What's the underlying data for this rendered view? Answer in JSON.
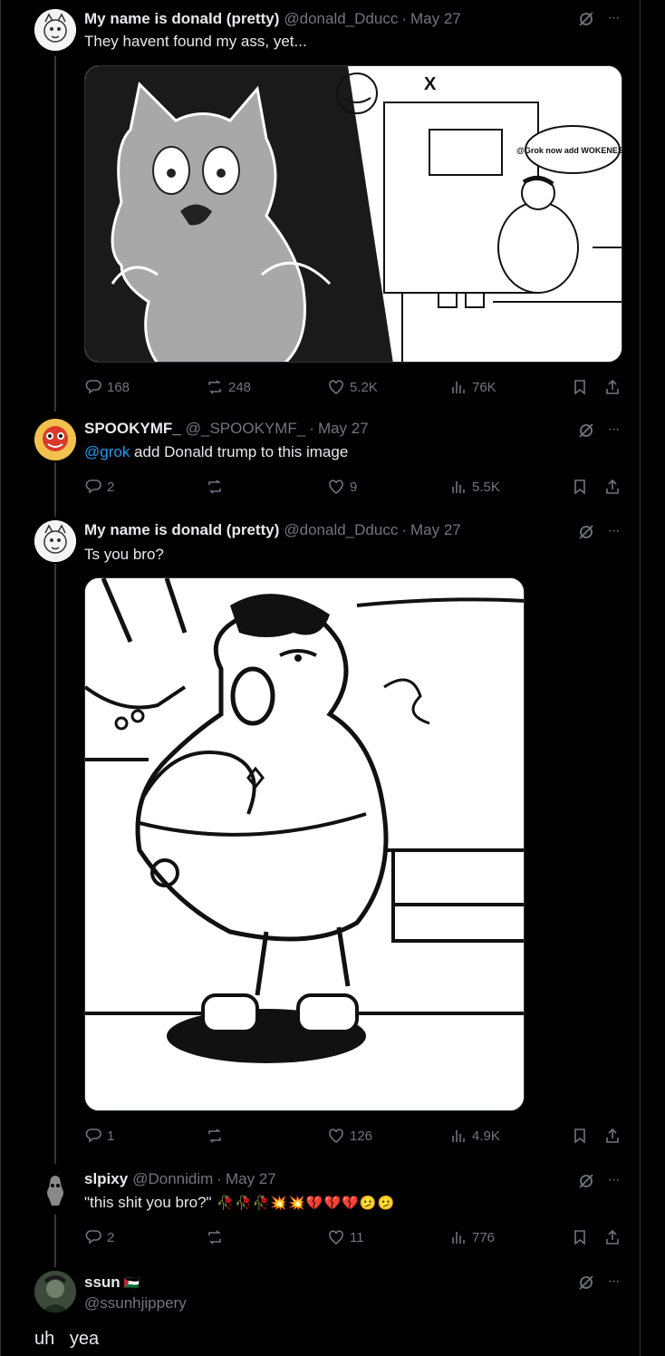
{
  "tweets": [
    {
      "name": "My name is donald (pretty)",
      "handle": "@donald_Dducc",
      "date": "May 27",
      "text": "They havent found my ass, yet...",
      "media_text": {
        "x_logo": "X",
        "grok_bubble": "@Grok now add WOKENESS"
      },
      "replies": "168",
      "reposts": "248",
      "likes": "5.2K",
      "views": "76K"
    },
    {
      "name": "SPOOKYMF_",
      "handle": "@_SPOOKYMF_",
      "date": "May 27",
      "mention": "@grok",
      "text": " add Donald trump to this image",
      "replies": "2",
      "reposts": "",
      "likes": "9",
      "views": "5.5K"
    },
    {
      "name": "My name is donald (pretty)",
      "handle": "@donald_Dducc",
      "date": "May 27",
      "text": "Ts you bro?",
      "replies": "1",
      "reposts": "",
      "likes": "126",
      "views": "4.9K"
    },
    {
      "name": "slpixy",
      "handle": "@Donnidim",
      "date": "May 27",
      "text": "\"this shit you bro?\"",
      "emojis": [
        "🥀",
        "🥀",
        "🥀",
        "💥",
        "💥",
        "💔",
        "💔",
        "💔",
        "🫤",
        "🫤"
      ],
      "replies": "2",
      "reposts": "",
      "likes": "11",
      "views": "776"
    },
    {
      "name": "ssun",
      "flag": "🇵🇸",
      "handle": "@ssunhjippery",
      "text": "uh   yea"
    }
  ],
  "colors": {
    "background": "#000000",
    "text": "#e7e9ea",
    "muted": "#71767b",
    "link": "#1d9bf0",
    "border": "#2f3336"
  },
  "icons": [
    "reply-icon",
    "repost-icon",
    "like-icon",
    "views-icon",
    "bookmark-icon",
    "share-icon",
    "grok-icon",
    "more-icon"
  ]
}
